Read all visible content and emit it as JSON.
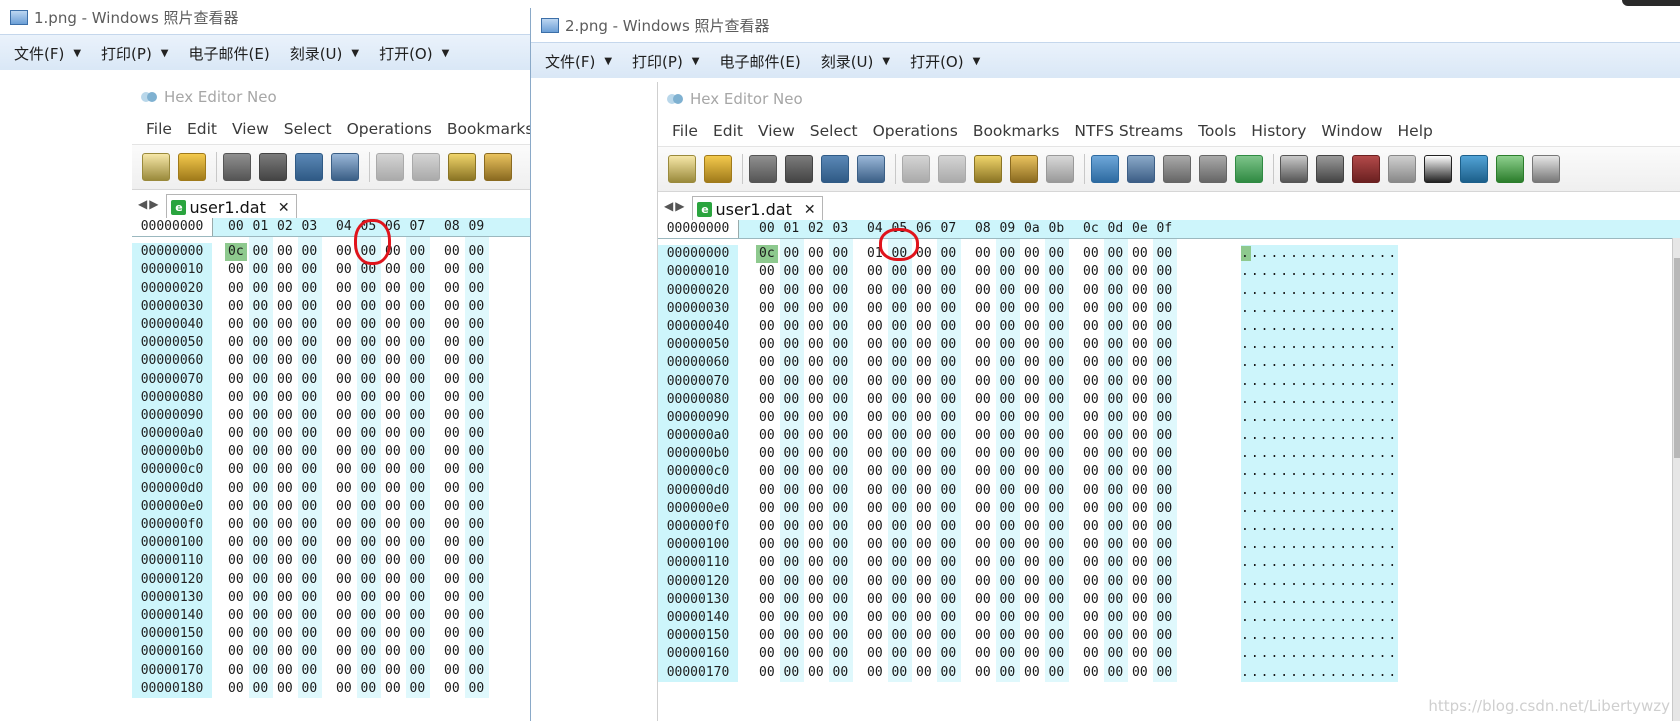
{
  "window1": {
    "title": "1.png - Windows 照片查看器",
    "menu": [
      "文件(F)",
      "打印(P)",
      "电子邮件(E)",
      "刻录(U)",
      "打开(O)"
    ],
    "menu_dropdown": [
      true,
      true,
      false,
      true,
      true
    ],
    "hex": {
      "app_title": "Hex Editor Neo",
      "menu": [
        "File",
        "Edit",
        "View",
        "Select",
        "Operations",
        "Bookmarks"
      ],
      "tab_label": "user1.dat",
      "offset_header": "00000000",
      "col_headers": [
        "00",
        "01",
        "02",
        "03",
        "04",
        "05",
        "06",
        "07",
        "08",
        "09"
      ],
      "first_row_values": [
        "0c",
        "00",
        "00",
        "00",
        "00",
        "00",
        "00",
        "00",
        "00",
        "00"
      ],
      "rows": [
        "00000000",
        "00000010",
        "00000020",
        "00000030",
        "00000040",
        "00000050",
        "00000060",
        "00000070",
        "00000080",
        "00000090",
        "000000a0",
        "000000b0",
        "000000c0",
        "000000d0",
        "000000e0",
        "000000f0",
        "00000100",
        "00000110",
        "00000120",
        "00000130",
        "00000140",
        "00000150",
        "00000160",
        "00000170",
        "00000180"
      ]
    }
  },
  "window2": {
    "title": "2.png - Windows 照片查看器",
    "menu": [
      "文件(F)",
      "打印(P)",
      "电子邮件(E)",
      "刻录(U)",
      "打开(O)"
    ],
    "menu_dropdown": [
      true,
      true,
      false,
      true,
      true
    ],
    "hex": {
      "app_title": "Hex Editor Neo",
      "menu": [
        "File",
        "Edit",
        "View",
        "Select",
        "Operations",
        "Bookmarks",
        "NTFS Streams",
        "Tools",
        "History",
        "Window",
        "Help"
      ],
      "tab_label": "user1.dat",
      "offset_header": "00000000",
      "col_headers": [
        "00",
        "01",
        "02",
        "03",
        "04",
        "05",
        "06",
        "07",
        "08",
        "09",
        "0a",
        "0b",
        "0c",
        "0d",
        "0e",
        "0f"
      ],
      "first_row_values": [
        "0c",
        "00",
        "00",
        "00",
        "01",
        "00",
        "00",
        "00",
        "00",
        "00",
        "00",
        "00",
        "00",
        "00",
        "00",
        "00"
      ],
      "rows": [
        "00000000",
        "00000010",
        "00000020",
        "00000030",
        "00000040",
        "00000050",
        "00000060",
        "00000070",
        "00000080",
        "00000090",
        "000000a0",
        "000000b0",
        "000000c0",
        "000000d0",
        "000000e0",
        "000000f0",
        "00000100",
        "00000110",
        "00000120",
        "00000130",
        "00000140",
        "00000150",
        "00000160",
        "00000170"
      ],
      "ascii_first": ".",
      "ascii_rest": "...............",
      "ascii_row": "................"
    }
  },
  "fill_byte": "00",
  "colors": {
    "selected_cell": "#8ec98e",
    "header_band": "#cdf5fb",
    "annotation": "#e0141c"
  },
  "watermark": "https://blog.csdn.net/Libertywzy"
}
